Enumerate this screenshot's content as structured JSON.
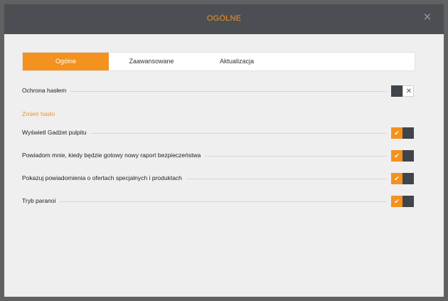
{
  "window": {
    "title": "OGÓLNE"
  },
  "tabs": [
    {
      "label": "Ogólne"
    },
    {
      "label": "Zaawansowane"
    },
    {
      "label": "Aktualizacja"
    }
  ],
  "settings": {
    "password_protection": {
      "label": "Ochrona hasłem"
    },
    "change_password_link": "Zmień hasło",
    "items": [
      {
        "label": "Wyświetl Gadżet pulpitu"
      },
      {
        "label": "Powiadom mnie, kiedy będzie gotowy nowy raport bezpieczeństwa"
      },
      {
        "label": "Pokazuj powiadomienia o ofertach specjalnych i produktach"
      },
      {
        "label": "Tryb paranoi"
      }
    ]
  },
  "icons": {
    "close": "close-icon",
    "check": "check-icon",
    "x": "x-icon"
  },
  "colors": {
    "accent": "#f3921f",
    "dark": "#3f454a"
  }
}
